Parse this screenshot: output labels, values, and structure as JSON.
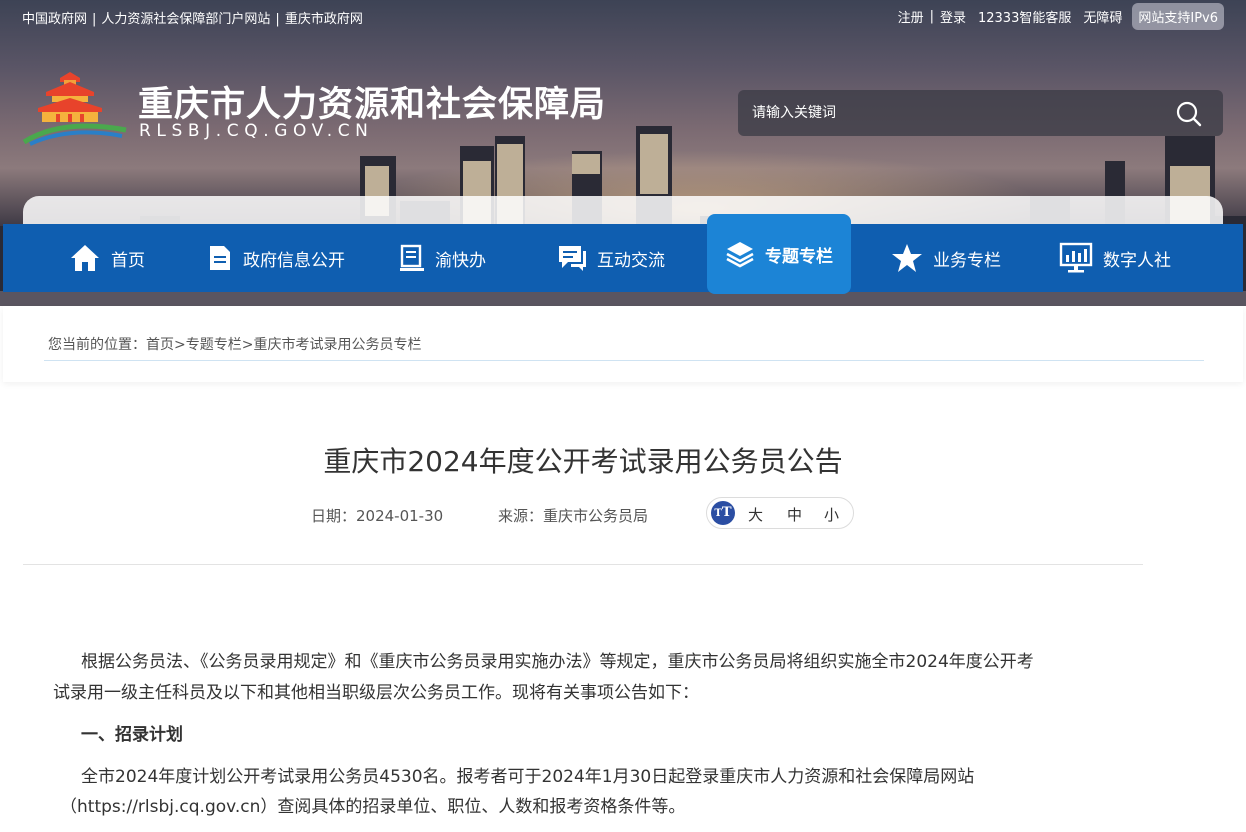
{
  "top_links_left": [
    "中国政府网",
    "人力资源社会保障部门户网站",
    "重庆市政府网"
  ],
  "top_links_right": {
    "register": "注册",
    "login": "登录",
    "service": "12333智能客服",
    "accessibility": "无障碍",
    "ipv6": "网站支持IPv6"
  },
  "site": {
    "title": "重庆市人力资源和社会保障局",
    "domain": "RLSBJ.CQ.GOV.CN"
  },
  "search": {
    "placeholder": "请输入关键词"
  },
  "nav": [
    {
      "label": "首页",
      "icon": "home-icon"
    },
    {
      "label": "政府信息公开",
      "icon": "document-icon"
    },
    {
      "label": "渝快办",
      "icon": "book-icon"
    },
    {
      "label": "互动交流",
      "icon": "chat-icon"
    },
    {
      "label": "专题专栏",
      "icon": "layers-icon",
      "active": true
    },
    {
      "label": "业务专栏",
      "icon": "star-icon"
    },
    {
      "label": "数字人社",
      "icon": "monitor-chart-icon"
    }
  ],
  "breadcrumb": {
    "prefix": "您当前的位置：",
    "items": [
      "首页",
      "专题专栏",
      "重庆市考试录用公务员专栏"
    ],
    "separator": ">"
  },
  "article": {
    "title": "重庆市2024年度公开考试录用公务员公告",
    "date": "日期：2024-01-30",
    "source": "来源：重庆市公务员局",
    "font_sizes": {
      "icon_text": "T",
      "large": "大",
      "medium": "中",
      "small": "小"
    },
    "paragraphs": [
      "根据公务员法、《公务员录用规定》和《重庆市公务员录用实施办法》等规定，重庆市公务员局将组织实施全市2024年度公开考",
      "试录用一级主任科员及以下和其他相当职级层次公务员工作。现将有关事项公告如下：",
      "一、招录计划",
      "全市2024年度计划公开考试录用公务员4530名。报考者可于2024年1月30日起登录重庆市人力资源和社会保障局网站",
      "（https://rlsbj.cq.gov.cn）查阅具体的招录单位、职位、人数和报考资格条件等。"
    ]
  }
}
